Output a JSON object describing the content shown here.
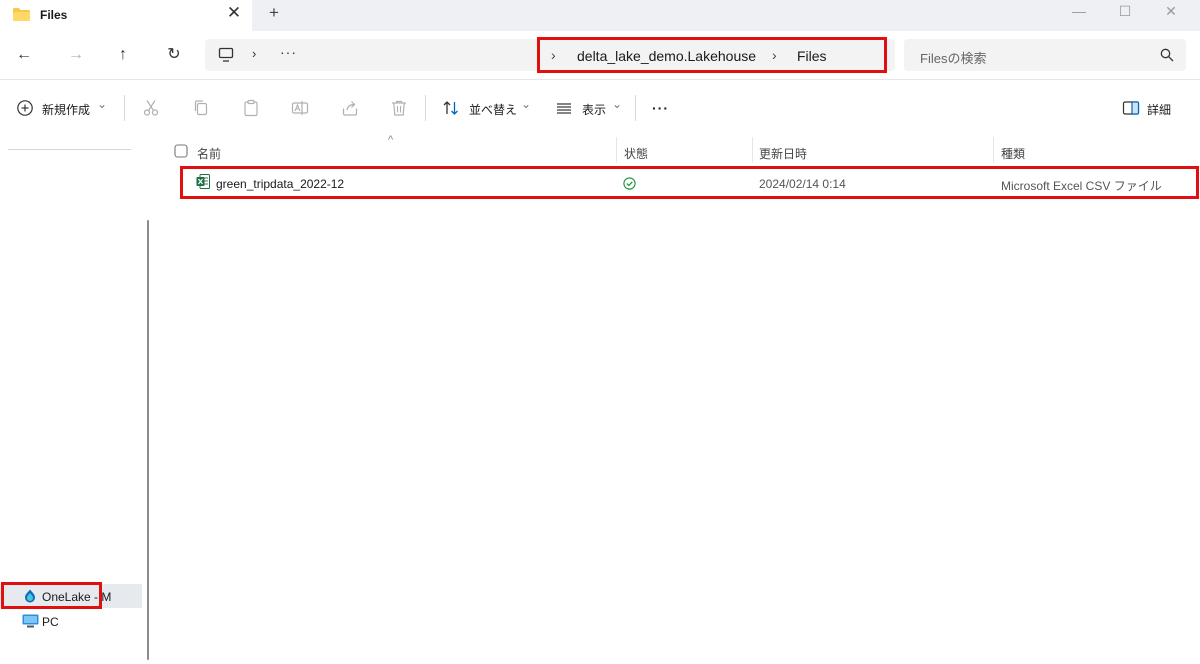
{
  "tab": {
    "title": "Files",
    "close_glyph": "✕",
    "new_glyph": "+"
  },
  "window_controls": {
    "minimize": "—",
    "maximize": "☐",
    "close": "✕"
  },
  "nav_buttons": {
    "back": "←",
    "forward": "→",
    "up": "↑",
    "refresh": "↻"
  },
  "address": {
    "chevron": "›",
    "more": "···",
    "breadcrumbs": [
      "delta_lake_demo.Lakehouse",
      "Files"
    ]
  },
  "search": {
    "placeholder": "Filesの検索"
  },
  "toolbar": {
    "new_label": "新規作成",
    "sort_label": "並べ替え",
    "view_label": "表示",
    "more_label": "···",
    "details_label": "詳細",
    "dropdown_glyph": "⌄"
  },
  "columns": {
    "name": "名前",
    "status": "状態",
    "modified": "更新日時",
    "type": "種類",
    "sort_arrow": "^"
  },
  "files": [
    {
      "name": "green_tripdata_2022-12",
      "status_icon": "sync-ok-check-icon",
      "modified": "2024/02/14 0:14",
      "type": "Microsoft Excel CSV ファイル"
    }
  ],
  "nav_pane": {
    "items": [
      {
        "label": "OneLake - M",
        "icon": "onelake-icon",
        "selected": true
      },
      {
        "label": "PC",
        "icon": "pc-monitor-icon",
        "selected": false
      }
    ]
  },
  "colors": {
    "highlight_red": "#e01010",
    "accent_blue": "#0067c0",
    "excel_green": "#1d7044",
    "folder_yellow": "#f7c948"
  }
}
